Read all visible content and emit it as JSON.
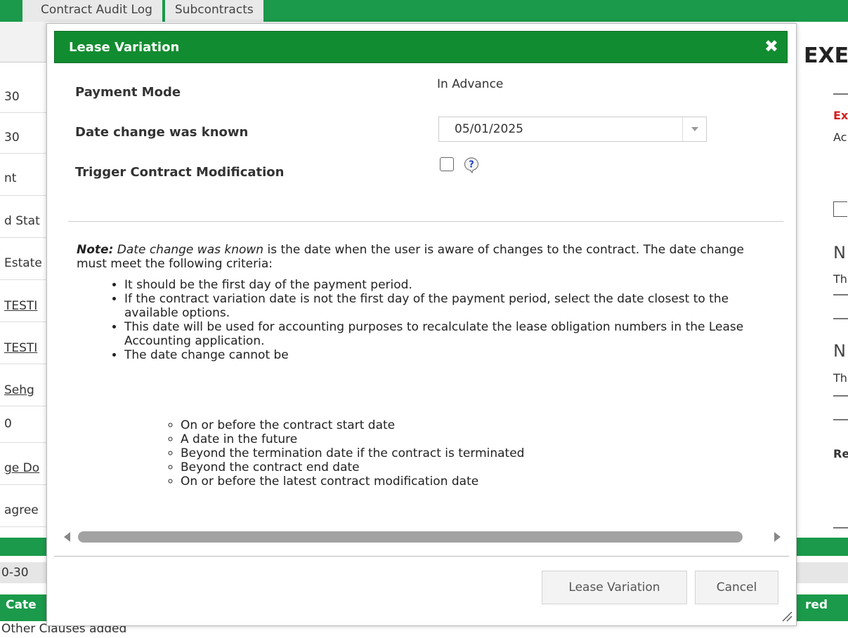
{
  "background": {
    "tabs": [
      "Contract Audit Log",
      "Subcontracts"
    ],
    "left_items": [
      {
        "text": "30",
        "link": false
      },
      {
        "text": "30",
        "link": false
      },
      {
        "text": "nt",
        "link": false
      },
      {
        "text": "d Stat",
        "link": false
      },
      {
        "text": "Estate",
        "link": false
      },
      {
        "text": "TESTI",
        "link": true
      },
      {
        "text": "TESTI",
        "link": true
      },
      {
        "text": "Sehg",
        "link": true
      },
      {
        "text": "0",
        "link": false
      },
      {
        "text": "ge Do",
        "link": true
      },
      {
        "text": "agree",
        "link": false
      }
    ],
    "row_text": "0-30",
    "header_left": "Cate",
    "header_right": "red",
    "bottom_text": "Other Clauses added",
    "right_big": "EXE",
    "right_texts": [
      "Ex",
      "Ac",
      "N",
      "Th",
      "N",
      "Th",
      "Re"
    ]
  },
  "modal": {
    "title": "Lease Variation",
    "close_symbol": "✖",
    "fields": {
      "payment_mode_label": "Payment Mode",
      "payment_mode_value": "In Advance",
      "date_known_label": "Date change was known",
      "date_known_value": "05/01/2025",
      "trigger_label": "Trigger Contract Modification",
      "trigger_checked": false
    },
    "note": {
      "prefix": "Note:",
      "term": "Date change was known",
      "text": " is the date when the user is aware of changes to the contract. The date change must meet the following criteria:"
    },
    "criteria": [
      "It should be the first day of the payment period.",
      "If the contract variation date is not the first day of the payment period, select the date closest to the available options.",
      "This date will be used for accounting purposes to recalculate the lease obligation numbers in the Lease Accounting application.",
      "The date change cannot be"
    ],
    "sub_criteria": [
      "On or before the contract start date",
      "A date in the future",
      "Beyond the termination date if the contract is terminated",
      "Beyond the contract end date",
      "On or before the latest contract modification date"
    ],
    "buttons": {
      "submit": "Lease Variation",
      "cancel": "Cancel"
    },
    "colors": {
      "header": "#128c30",
      "page_green": "#1a9a4a",
      "help_icon": "#1f3fbf"
    }
  }
}
